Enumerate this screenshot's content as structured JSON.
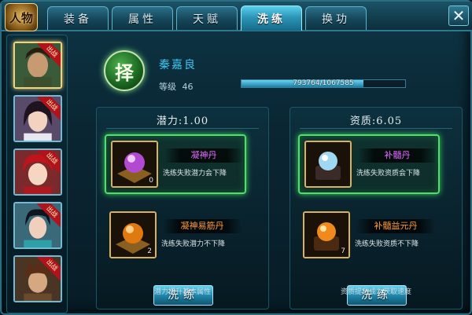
{
  "header": {
    "logo_text": "人物",
    "tabs": [
      {
        "label": "装备",
        "active": false
      },
      {
        "label": "属性",
        "active": false
      },
      {
        "label": "天赋",
        "active": false
      },
      {
        "label": "洗练",
        "active": true
      },
      {
        "label": "换功",
        "active": false
      }
    ],
    "close_label": "✕"
  },
  "sidebar": {
    "heroes": [
      {
        "name": "hero-1",
        "badge": "出战",
        "selected": true
      },
      {
        "name": "hero-2",
        "badge": "出战",
        "selected": false
      },
      {
        "name": "hero-3",
        "badge": "出战",
        "selected": false
      },
      {
        "name": "hero-4",
        "badge": "出战",
        "selected": false
      },
      {
        "name": "hero-5",
        "badge": "出战",
        "selected": false
      }
    ]
  },
  "hero": {
    "emblem_char": "择",
    "name": "秦嘉良",
    "level_label": "等级",
    "level_value": "46",
    "exp_text": "793764/1067585",
    "exp_fraction": 0.7435
  },
  "potential_panel": {
    "title": "潜力:1.00",
    "items": [
      {
        "name": "凝神丹",
        "name_color": "#e36cff",
        "desc": "洗练失败潜力会下降",
        "count": "0",
        "selected": true
      },
      {
        "name": "凝神易筋丹",
        "name_color": "#ff9b3c",
        "desc": "洗练失败潜力不下降",
        "count": "2",
        "selected": false
      }
    ],
    "button_label": "洗练",
    "note": "潜力提升基本属性"
  },
  "aptitude_panel": {
    "title": "资质:6.05",
    "items": [
      {
        "name": "补髓丹",
        "name_color": "#e36cff",
        "desc": "洗练失败资质会下降",
        "count": "",
        "selected": true
      },
      {
        "name": "补髓益元丹",
        "name_color": "#ff9b3c",
        "desc": "洗练失败资质不下降",
        "count": "7",
        "selected": false
      }
    ],
    "button_label": "洗练",
    "note": "资质提升成为获取速度"
  }
}
